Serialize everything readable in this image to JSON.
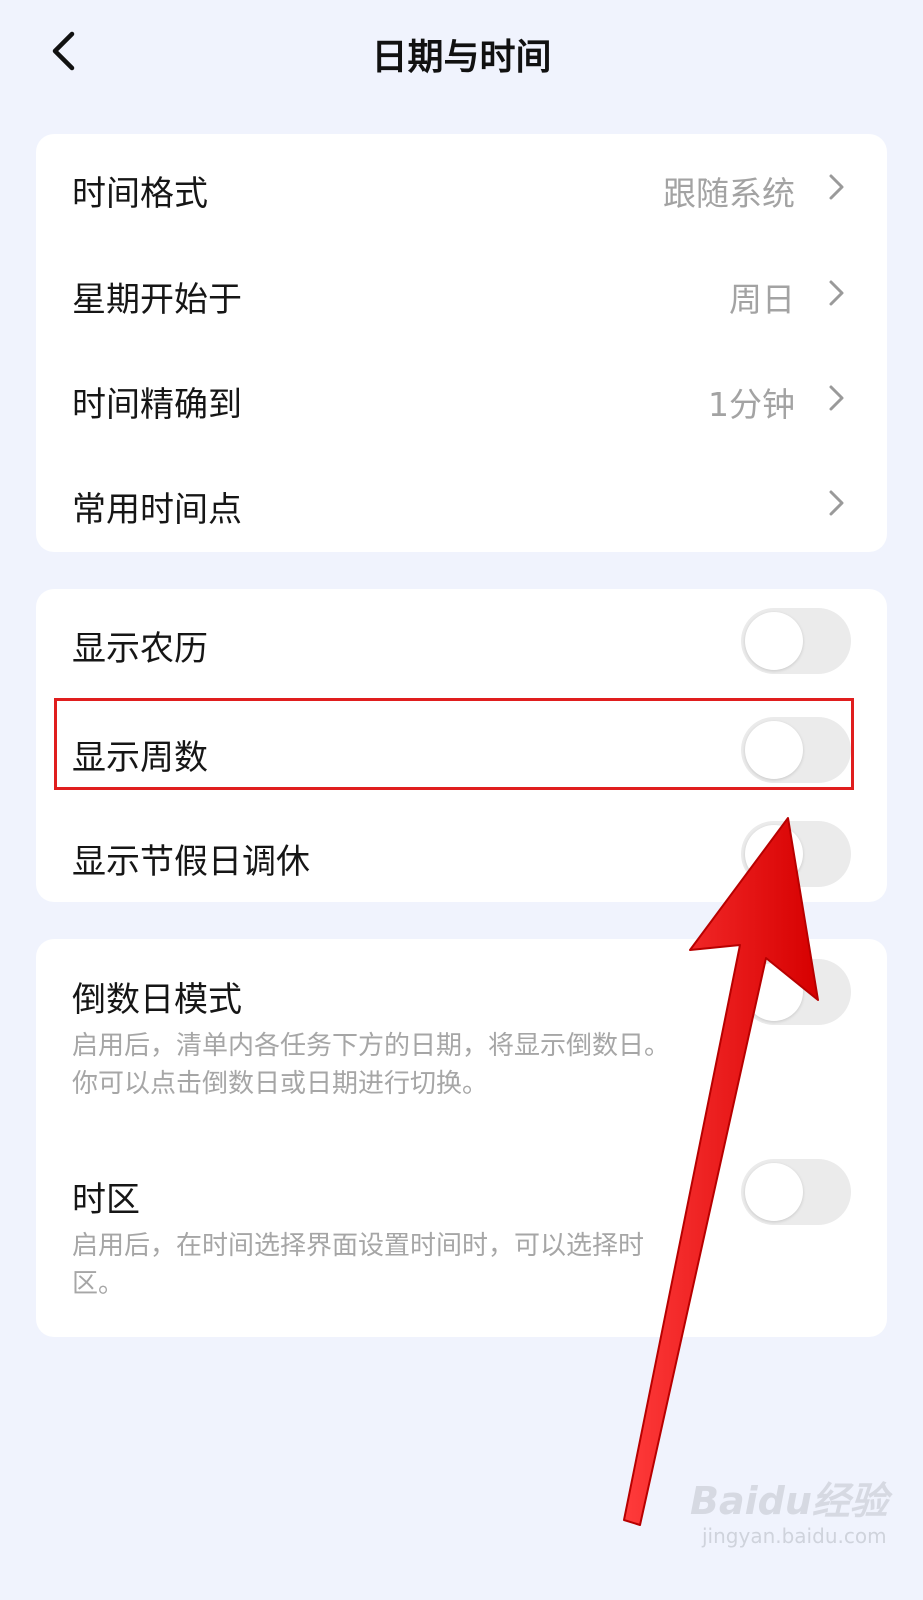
{
  "header": {
    "title": "日期与时间"
  },
  "section1": {
    "rows": [
      {
        "label": "时间格式",
        "value": "跟随系统"
      },
      {
        "label": "星期开始于",
        "value": "周日"
      },
      {
        "label": "时间精确到",
        "value": "1分钟"
      },
      {
        "label": "常用时间点",
        "value": ""
      }
    ]
  },
  "section2": {
    "rows": [
      {
        "label": "显示农历",
        "on": false
      },
      {
        "label": "显示周数",
        "on": false
      },
      {
        "label": "显示节假日调休",
        "on": false
      }
    ]
  },
  "section3": {
    "rows": [
      {
        "label": "倒数日模式",
        "on": false,
        "desc_line1": "启用后，清单内各任务下方的日期，将显示倒数日。",
        "desc_line2": "你可以点击倒数日或日期进行切换。"
      },
      {
        "label": "时区",
        "on": false,
        "desc_line1": "启用后，在时间选择界面设置时间时，可以选择时",
        "desc_line2": "区。"
      }
    ]
  },
  "colors": {
    "background": "#f0f3fd",
    "annotation_red": "#e01e1e",
    "toggle_off": "#ebebeb"
  },
  "watermark": {
    "brand": "Baidu经验",
    "site": "jingyan.baidu.com"
  }
}
